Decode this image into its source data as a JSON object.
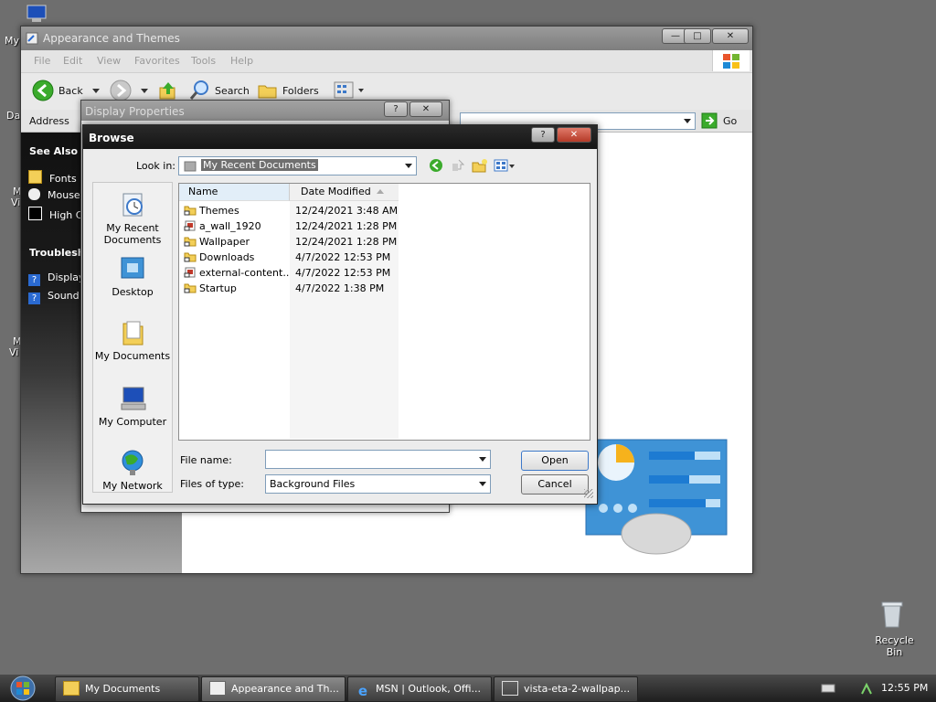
{
  "desktop": {
    "labels_left": [
      "My",
      "Da",
      "M",
      "Vi",
      "M",
      "Vi"
    ],
    "recycle_bin": "Recycle Bin"
  },
  "explorer": {
    "title": "Appearance and Themes",
    "menu": [
      "File",
      "Edit",
      "View",
      "Favorites",
      "Tools",
      "Help"
    ],
    "toolbar": {
      "back": "Back",
      "search": "Search",
      "folders": "Folders"
    },
    "address_label": "Address",
    "go": "Go",
    "see_also": {
      "heading": "See Also",
      "items": [
        "Fonts",
        "Mouse",
        "High C"
      ]
    },
    "troubleshooters": {
      "heading": "Troublesho",
      "items": [
        "Display",
        "Sound"
      ]
    }
  },
  "display_properties": {
    "title": "Display Properties"
  },
  "browse": {
    "title": "Browse",
    "look_in_label": "Look in:",
    "look_in_value": "My Recent Documents",
    "places": [
      "My Recent Documents",
      "Desktop",
      "My Documents",
      "My Computer",
      "My Network"
    ],
    "columns": {
      "name": "Name",
      "date": "Date Modified"
    },
    "files": [
      {
        "name": "Themes",
        "date": "12/24/2021 3:48 AM",
        "icon": "folder-shortcut-icon"
      },
      {
        "name": "a_wall_1920",
        "date": "12/24/2021 1:28 PM",
        "icon": "image-shortcut-icon"
      },
      {
        "name": "Wallpaper",
        "date": "12/24/2021 1:28 PM",
        "icon": "folder-shortcut-icon"
      },
      {
        "name": "Downloads",
        "date": "4/7/2022 12:53 PM",
        "icon": "folder-shortcut-icon"
      },
      {
        "name": "external-content...",
        "date": "4/7/2022 12:53 PM",
        "icon": "image-shortcut-icon"
      },
      {
        "name": "Startup",
        "date": "4/7/2022 1:38 PM",
        "icon": "folder-shortcut-icon"
      }
    ],
    "file_name_label": "File name:",
    "file_name_value": "",
    "files_of_type_label": "Files of type:",
    "files_of_type_value": "Background Files",
    "open": "Open",
    "cancel": "Cancel"
  },
  "taskbar": {
    "tasks": [
      {
        "label": "My Documents",
        "icon": "folder-icon"
      },
      {
        "label": "Appearance and Th...",
        "icon": "control-panel-icon"
      },
      {
        "label": "MSN | Outlook, Offi...",
        "icon": "ie-icon"
      },
      {
        "label": "vista-eta-2-wallpap...",
        "icon": "image-viewer-icon"
      }
    ],
    "clock": "12:55 PM"
  }
}
